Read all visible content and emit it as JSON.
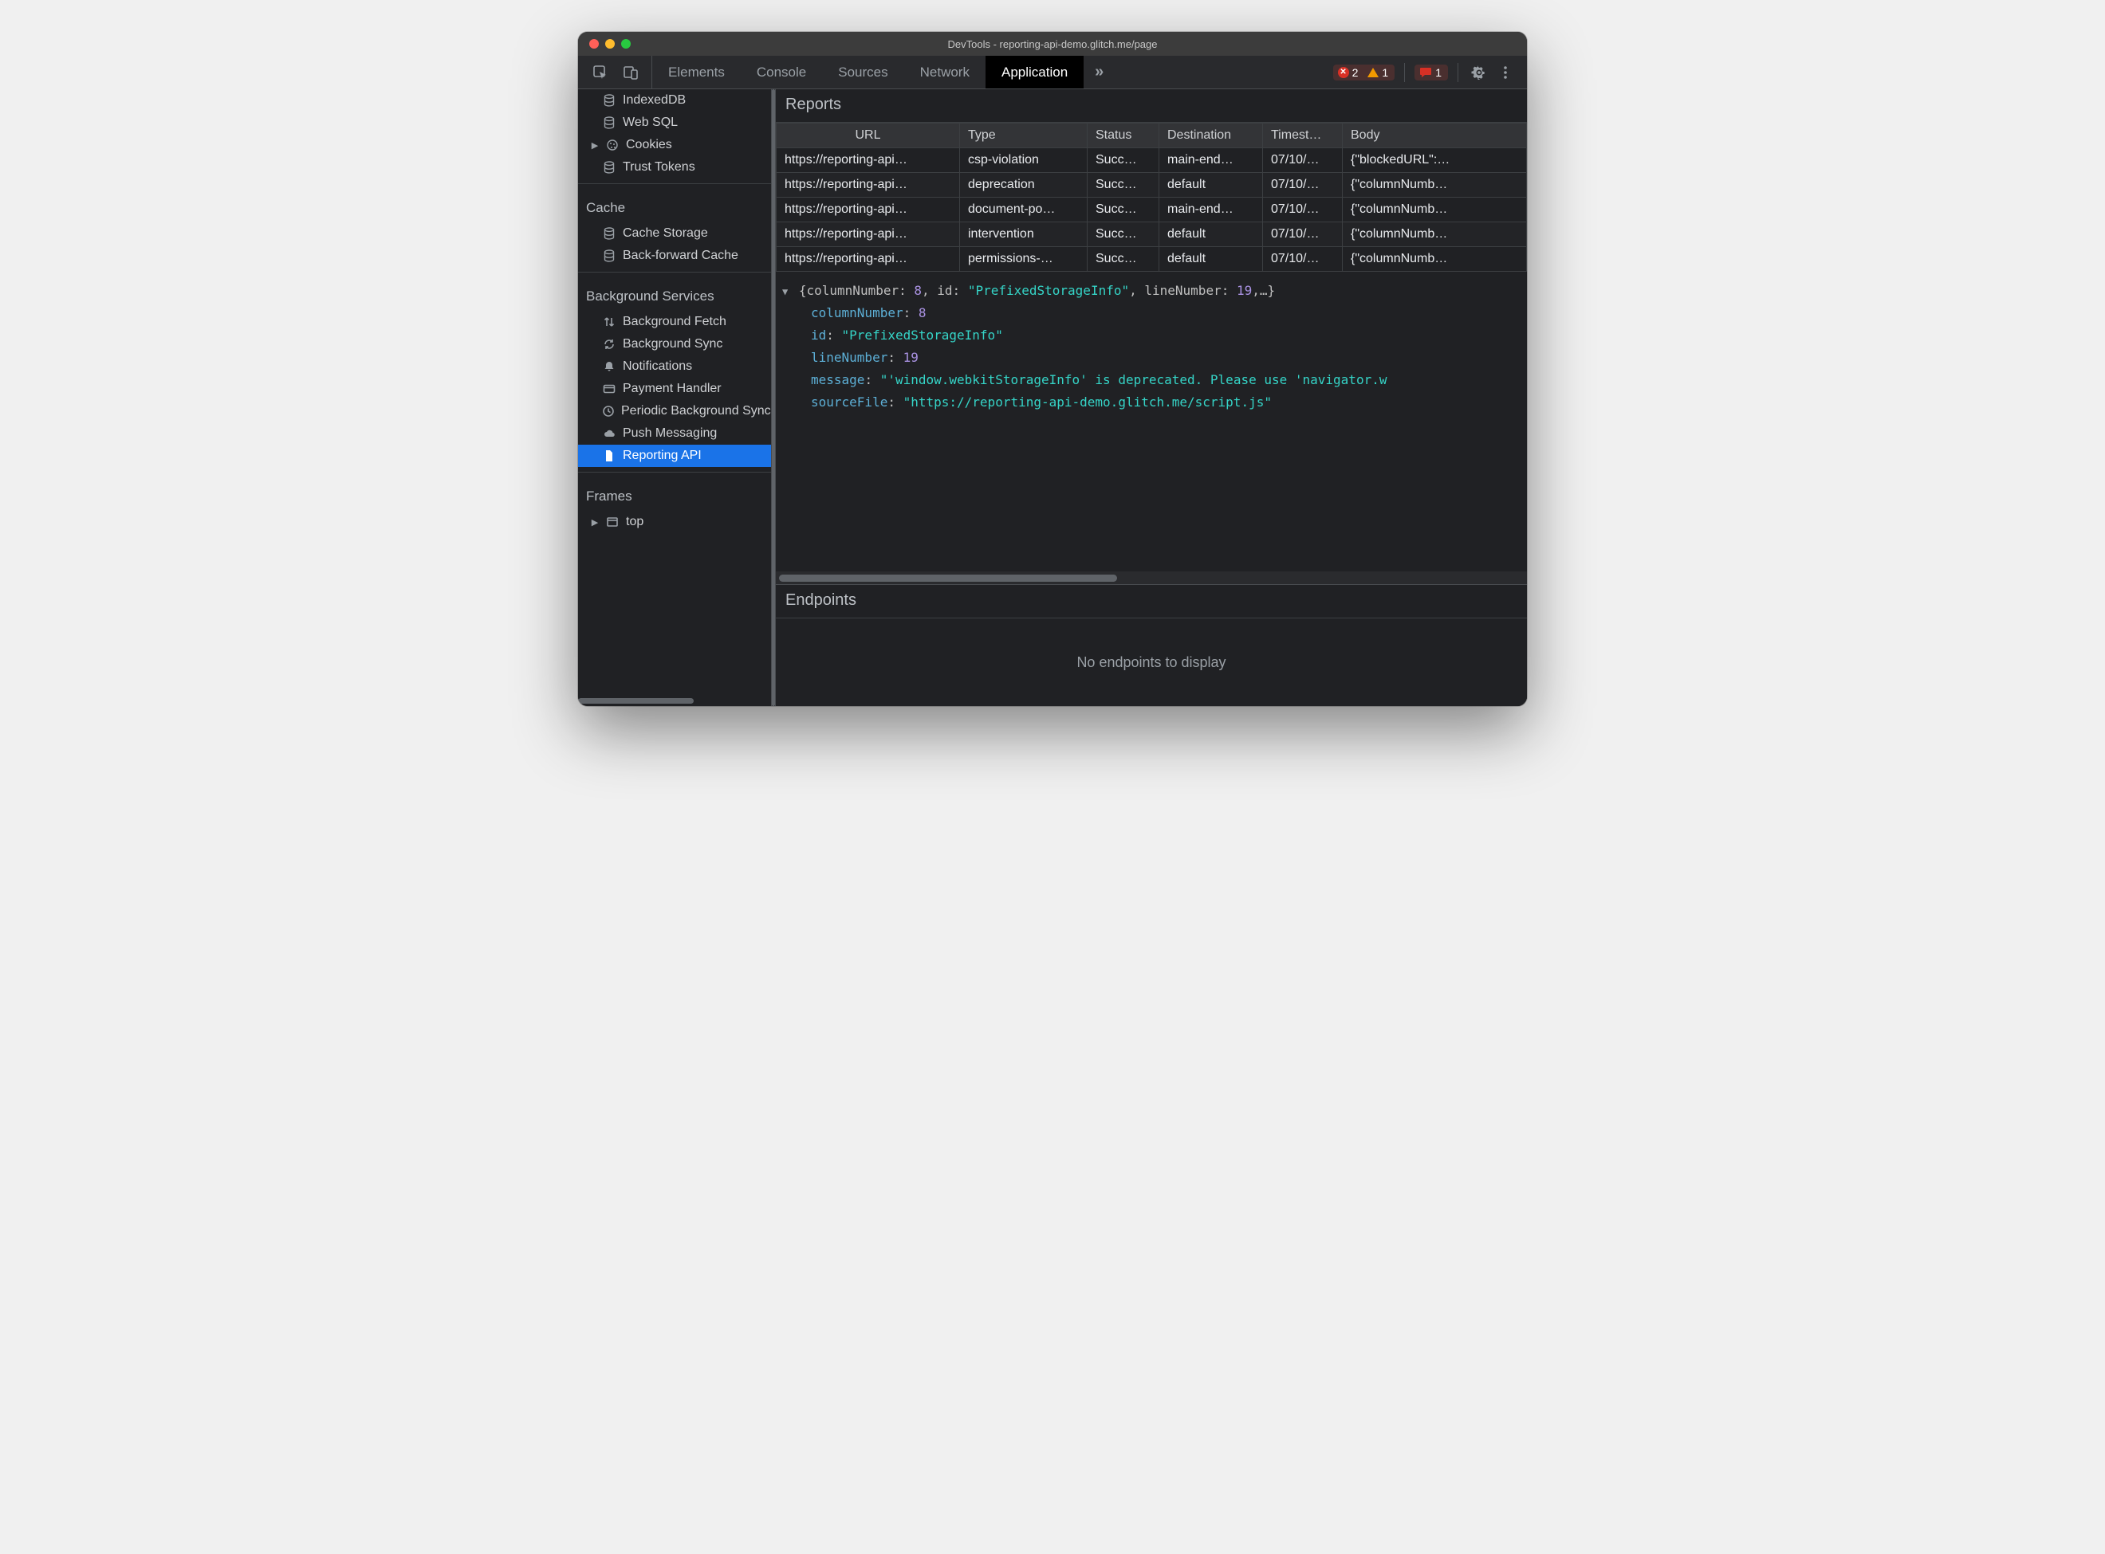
{
  "window": {
    "title": "DevTools - reporting-api-demo.glitch.me/page"
  },
  "toolbar": {
    "tabs": [
      "Elements",
      "Console",
      "Sources",
      "Network",
      "Application"
    ],
    "active_tab_index": 4,
    "more_glyph": "»",
    "error_count": "2",
    "warn_count": "1",
    "issue_count": "1"
  },
  "sidebar": {
    "storage_items": [
      {
        "label": "IndexedDB",
        "icon": "db"
      },
      {
        "label": "Web SQL",
        "icon": "db"
      },
      {
        "label": "Cookies",
        "icon": "cookie",
        "expandable": true
      },
      {
        "label": "Trust Tokens",
        "icon": "db"
      }
    ],
    "cache_title": "Cache",
    "cache_items": [
      {
        "label": "Cache Storage",
        "icon": "db"
      },
      {
        "label": "Back-forward Cache",
        "icon": "db"
      }
    ],
    "bg_title": "Background Services",
    "bg_items": [
      {
        "label": "Background Fetch",
        "icon": "updown"
      },
      {
        "label": "Background Sync",
        "icon": "sync"
      },
      {
        "label": "Notifications",
        "icon": "bell"
      },
      {
        "label": "Payment Handler",
        "icon": "card"
      },
      {
        "label": "Periodic Background Sync",
        "icon": "clock"
      },
      {
        "label": "Push Messaging",
        "icon": "cloud"
      },
      {
        "label": "Reporting API",
        "icon": "file",
        "selected": true
      }
    ],
    "frames_title": "Frames",
    "frames_items": [
      {
        "label": "top",
        "icon": "frame",
        "expandable": true
      }
    ]
  },
  "reports": {
    "title": "Reports",
    "columns": [
      "URL",
      "Type",
      "Status",
      "Destination",
      "Timest…",
      "Body"
    ],
    "rows": [
      {
        "url": "https://reporting-api…",
        "type": "csp-violation",
        "status": "Succ…",
        "dest": "main-end…",
        "ts": "07/10/…",
        "body": "{\"blockedURL\":…"
      },
      {
        "url": "https://reporting-api…",
        "type": "deprecation",
        "status": "Succ…",
        "dest": "default",
        "ts": "07/10/…",
        "body": "{\"columnNumb…"
      },
      {
        "url": "https://reporting-api…",
        "type": "document-po…",
        "status": "Succ…",
        "dest": "main-end…",
        "ts": "07/10/…",
        "body": "{\"columnNumb…"
      },
      {
        "url": "https://reporting-api…",
        "type": "intervention",
        "status": "Succ…",
        "dest": "default",
        "ts": "07/10/…",
        "body": "{\"columnNumb…"
      },
      {
        "url": "https://reporting-api…",
        "type": "permissions-…",
        "status": "Succ…",
        "dest": "default",
        "ts": "07/10/…",
        "body": "{\"columnNumb…"
      }
    ]
  },
  "detail": {
    "summary_prefix": "{columnNumber: ",
    "summary_col": "8",
    "summary_mid1": ", id: ",
    "summary_id": "\"PrefixedStorageInfo\"",
    "summary_mid2": ", lineNumber: ",
    "summary_line": "19",
    "summary_suffix": ",…}",
    "props": [
      {
        "key": "columnNumber",
        "type": "num",
        "value": "8"
      },
      {
        "key": "id",
        "type": "str",
        "value": "\"PrefixedStorageInfo\""
      },
      {
        "key": "lineNumber",
        "type": "num",
        "value": "19"
      },
      {
        "key": "message",
        "type": "str",
        "value": "\"'window.webkitStorageInfo' is deprecated. Please use 'navigator.w"
      },
      {
        "key": "sourceFile",
        "type": "str",
        "value": "\"https://reporting-api-demo.glitch.me/script.js\""
      }
    ]
  },
  "endpoints": {
    "title": "Endpoints",
    "empty": "No endpoints to display"
  }
}
